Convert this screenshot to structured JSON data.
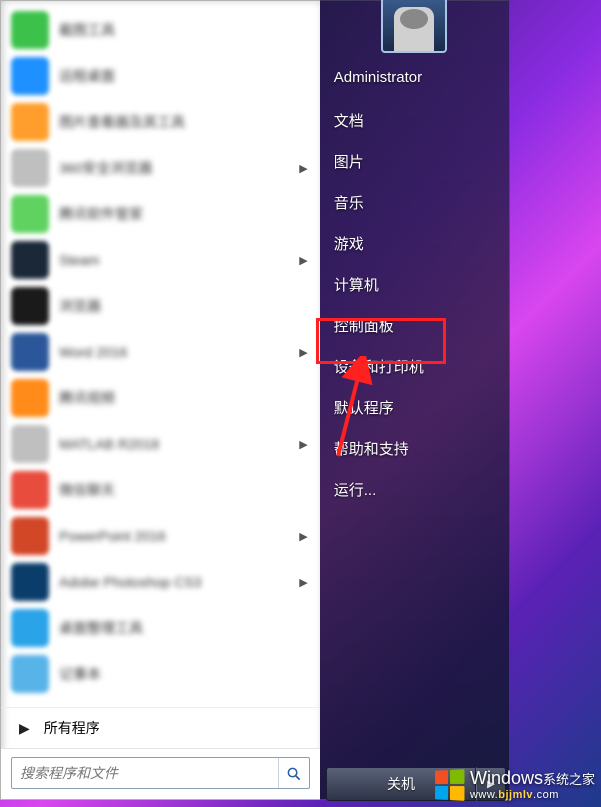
{
  "programs": [
    {
      "label": "截图工具",
      "color": "#3cc24a",
      "has_sub": false
    },
    {
      "label": "远程桌面",
      "color": "#1e90ff",
      "has_sub": false
    },
    {
      "label": "图片查看器及其工具",
      "color": "#ff9e2c",
      "has_sub": false
    },
    {
      "label": "360安全浏览器",
      "color": "#bfbfbf",
      "has_sub": true
    },
    {
      "label": "腾讯软件管家",
      "color": "#5fd25f",
      "has_sub": false
    },
    {
      "label": "Steam",
      "color": "#1b2838",
      "has_sub": true
    },
    {
      "label": "浏览器",
      "color": "#1a1a1a",
      "has_sub": false
    },
    {
      "label": "Word 2016",
      "color": "#2b579a",
      "has_sub": true
    },
    {
      "label": "腾讯视频",
      "color": "#ff8c1a",
      "has_sub": false
    },
    {
      "label": "MATLAB R2018",
      "color": "#bfbfbf",
      "has_sub": true
    },
    {
      "label": "微信聊天",
      "color": "#e74c3c",
      "has_sub": false
    },
    {
      "label": "PowerPoint 2016",
      "color": "#d24726",
      "has_sub": true
    },
    {
      "label": "Adobe Photoshop CS3",
      "color": "#0b3d6b",
      "has_sub": true
    },
    {
      "label": "桌面整理工具",
      "color": "#2aa3e8",
      "has_sub": false
    },
    {
      "label": "记事本",
      "color": "#57b3e8",
      "has_sub": false
    }
  ],
  "all_programs_label": "所有程序",
  "search_placeholder": "搜索程序和文件",
  "right_panel": [
    "Administrator",
    "文档",
    "图片",
    "音乐",
    "游戏",
    "计算机",
    "控制面板",
    "设备和打印机",
    "默认程序",
    "帮助和支持",
    "运行..."
  ],
  "shutdown_label": "关机",
  "watermark": {
    "brand": "Windows",
    "sub_prefix": "系统之家",
    "url_host": "www.",
    "url_highlight": "bjjmlv",
    "url_suffix": ".com"
  },
  "colors": {
    "win_tl": "#f25022",
    "win_tr": "#7fba00",
    "win_bl": "#00a4ef",
    "win_br": "#ffb900"
  }
}
